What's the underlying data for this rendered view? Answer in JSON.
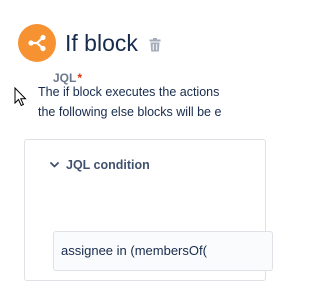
{
  "block": {
    "title": "If block",
    "icon": "branch-icon",
    "delete_icon": "trash-icon",
    "accent_color": "#f79232"
  },
  "description": {
    "line1": "The if block executes the actions",
    "line2": "the following else blocks will be e"
  },
  "condition": {
    "title": "JQL condition",
    "expand_icon": "chevron-down-icon",
    "field_label": "JQL",
    "required_marker": "*",
    "value": "assignee in (membersOf("
  }
}
